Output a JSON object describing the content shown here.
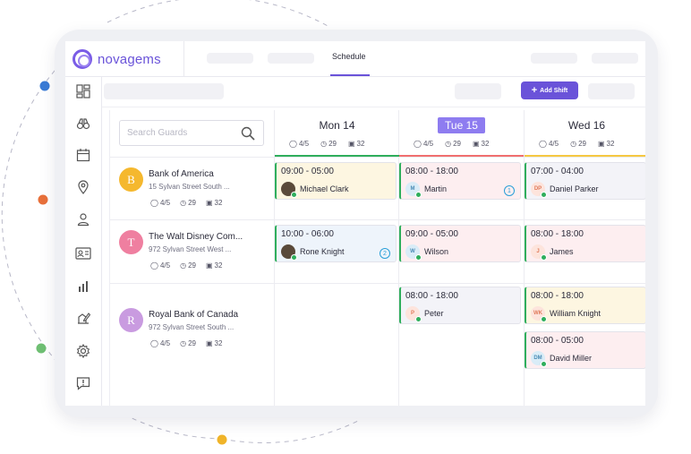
{
  "app": {
    "brand": "novagems"
  },
  "header": {
    "tabs": [
      {
        "label": "Schedule",
        "active": true
      }
    ]
  },
  "toolbar": {
    "add_shift_label": "Add Shift"
  },
  "search": {
    "placeholder": "Search Guards"
  },
  "colors": {
    "accent": "#6a53d9",
    "green": "#2fae5c",
    "red": "#f06f6f",
    "yellow": "#f5c842",
    "blue_dot": "#3a7bd5",
    "orange_dot": "#e8703a",
    "green_dot": "#6fbf73",
    "gold_dot": "#f0b429"
  },
  "days": [
    {
      "label": "Mon 14",
      "guards": "4/5",
      "hours": "29",
      "shifts": "32",
      "bar_color": "green",
      "today": false
    },
    {
      "label": "Tue 15",
      "guards": "4/5",
      "hours": "29",
      "shifts": "32",
      "bar_color": "red",
      "today": true
    },
    {
      "label": "Wed 16",
      "guards": "4/5",
      "hours": "29",
      "shifts": "32",
      "bar_color": "yellow",
      "today": false
    }
  ],
  "sites": [
    {
      "initial": "B",
      "name": "Bank of America",
      "address": "15 Sylvan Street South ...",
      "guards": "4/5",
      "hours": "29",
      "shifts": "32",
      "color": "#f5b82e"
    },
    {
      "initial": "T",
      "name": "The Walt Disney Com...",
      "address": "972 Sylvan Street West ...",
      "guards": "4/5",
      "hours": "29",
      "shifts": "32",
      "color": "#ef7fa0"
    },
    {
      "initial": "R",
      "name": "Royal Bank of Canada",
      "address": "972 Sylvan Street South ...",
      "guards": "4/5",
      "hours": "29",
      "shifts": "32",
      "color": "#c99be0"
    }
  ],
  "shifts": {
    "mon_bank": {
      "time": "09:00 - 05:00",
      "person": "Michael Clark",
      "avatar": "photo"
    },
    "mon_disney": {
      "time": "10:00 - 06:00",
      "person": "Rone Knight",
      "avatar": "photo",
      "badge": "2"
    },
    "tue_bank": {
      "time": "08:00 - 18:00",
      "person": "Martin",
      "avatar": "M",
      "badge": "1"
    },
    "tue_disney": {
      "time": "09:00 - 05:00",
      "person": "Wilson",
      "avatar": "W"
    },
    "tue_royal": {
      "time": "08:00 - 18:00",
      "person": "Peter",
      "avatar": "P"
    },
    "wed_bank": {
      "time": "07:00 - 04:00",
      "person": "Daniel Parker",
      "avatar": "DP"
    },
    "wed_disney": {
      "time": "08:00 - 18:00",
      "person": "James",
      "avatar": "J"
    },
    "wed_royal_1": {
      "time": "08:00 - 18:00",
      "person": "William Knight",
      "avatar": "WK"
    },
    "wed_royal_2": {
      "time": "08:00 - 05:00",
      "person": "David Miller",
      "avatar": "DM"
    }
  }
}
